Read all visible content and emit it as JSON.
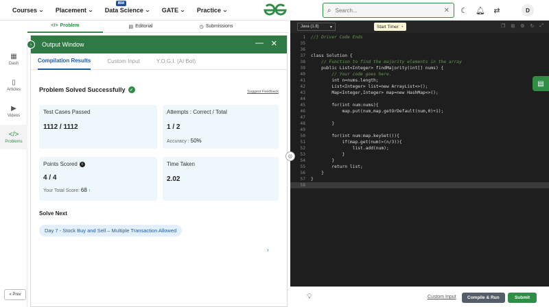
{
  "nav": {
    "items": [
      {
        "label": "Courses"
      },
      {
        "label": "Placement"
      },
      {
        "label": "Data Science",
        "badge": "IBM"
      },
      {
        "label": "GATE"
      },
      {
        "label": "Practice"
      }
    ],
    "search_placeholder": "Search...",
    "avatar_letter": "D",
    "brand_color": "#2f8d46"
  },
  "rail": {
    "items": [
      {
        "label": "Dash",
        "icon": "dashboard-icon"
      },
      {
        "label": "Articles",
        "icon": "book-icon"
      },
      {
        "label": "Videos",
        "icon": "video-icon"
      },
      {
        "label": "Problems",
        "icon": "code-icon",
        "active": true
      }
    ],
    "prev_label": "« Prev"
  },
  "problem_tabs": [
    {
      "label": "Problem",
      "active": true
    },
    {
      "label": "Editorial"
    },
    {
      "label": "Submissions"
    }
  ],
  "output": {
    "title": "Output Window",
    "tabs": [
      {
        "label": "Compilation Results",
        "active": true
      },
      {
        "label": "Custom Input"
      },
      {
        "label": "Y.O.G.I. (AI Bot)"
      }
    ],
    "status": "Problem Solved Successfully",
    "suggest_feedback": "Suggest Feedback",
    "cards": {
      "tests_label": "Test Cases Passed",
      "tests_value": "1112 / 1112",
      "attempts_label": "Attempts : Correct / Total",
      "attempts_value": "1 / 2",
      "accuracy_label": "Accuracy :",
      "accuracy_value": "50%",
      "points_label": "Points Scored",
      "points_value": "4 / 4",
      "total_score_label": "Your Total Score:",
      "total_score_value": "68",
      "time_label": "Time Taken",
      "time_value": "2.02"
    },
    "solve_next_label": "Solve Next",
    "solve_next_item": "Day 7 - Stock Buy and Sell – Multiple Transaction Allowed"
  },
  "editor": {
    "language": "Java (1.8)",
    "timer_label": "Start Timer",
    "lines": [
      {
        "no": "1",
        "text": "//} Driver Code Ends",
        "kind": "cm"
      },
      {
        "no": "35",
        "text": ""
      },
      {
        "no": "36",
        "text": ""
      },
      {
        "no": "37",
        "text": "class Solution {"
      },
      {
        "no": "38",
        "text": "    // Function to find the majority elements in the array",
        "kind": "cm"
      },
      {
        "no": "39",
        "text": "    public List<Integer> findMajority(int[] nums) {"
      },
      {
        "no": "40",
        "text": "        // Your code goes here.",
        "kind": "cm"
      },
      {
        "no": "41",
        "text": "        int n=nums.length;"
      },
      {
        "no": "42",
        "text": "        List<Integer> list=new ArrayList<>();"
      },
      {
        "no": "43",
        "text": "        Map<Integer,Integer> map=new HashMap<>();"
      },
      {
        "no": "44",
        "text": ""
      },
      {
        "no": "45",
        "text": "        for(int num:nums){"
      },
      {
        "no": "46",
        "text": "            map.put(num,map.getOrDefault(num,0)+1);"
      },
      {
        "no": "47",
        "text": ""
      },
      {
        "no": "48",
        "text": "        }"
      },
      {
        "no": "49",
        "text": ""
      },
      {
        "no": "50",
        "text": "        for(int num:map.keySet()){"
      },
      {
        "no": "51",
        "text": "            if(map.get(num)>(n/3)){"
      },
      {
        "no": "52",
        "text": "                list.add(num);"
      },
      {
        "no": "53",
        "text": "            }"
      },
      {
        "no": "54",
        "text": "        }"
      },
      {
        "no": "55",
        "text": "        return list;"
      },
      {
        "no": "56",
        "text": "    }"
      },
      {
        "no": "57",
        "text": "}"
      },
      {
        "no": "58",
        "text": "",
        "highlight": true
      }
    ]
  },
  "bottom": {
    "custom_input": "Custom Input",
    "compile_run": "Compile & Run",
    "submit": "Submit"
  }
}
